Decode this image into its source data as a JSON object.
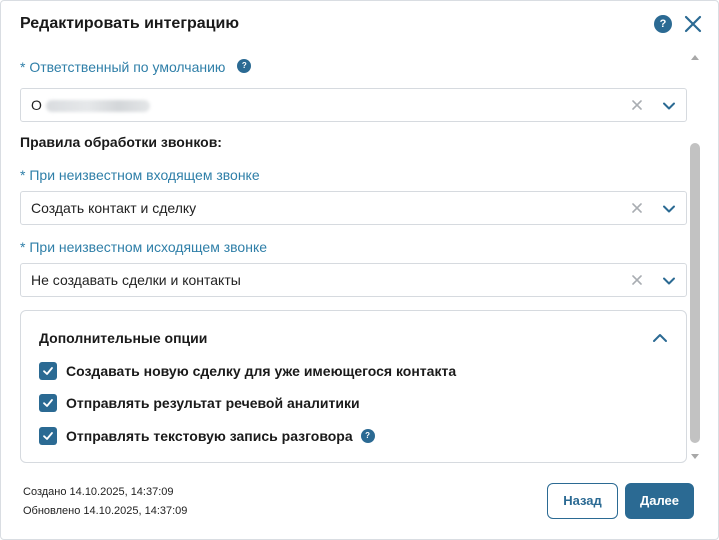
{
  "dialog": {
    "title": "Редактировать интеграцию",
    "help_icon": "?"
  },
  "responsible": {
    "required_mark": "*",
    "label": "Ответственный по умолчанию",
    "help_icon": "?",
    "value_prefix": "О"
  },
  "rules_title": "Правила обработки звонков:",
  "incoming": {
    "required_mark": "*",
    "label": "При неизвестном входящем звонке",
    "value": "Создать контакт и сделку"
  },
  "outgoing": {
    "required_mark": "*",
    "label": "При неизвестном исходящем звонке",
    "value": "Не создавать сделки и контакты"
  },
  "options": {
    "title": "Дополнительные опции",
    "items": [
      {
        "label": "Создавать новую сделку для уже имеющегося контакта",
        "checked": true
      },
      {
        "label": "Отправлять результат речевой аналитики",
        "checked": true
      },
      {
        "label": "Отправлять текстовую запись разговора",
        "checked": true,
        "help_icon": "?"
      }
    ]
  },
  "footer": {
    "created": "Создано 14.10.2025, 14:37:09",
    "updated": "Обновлено 14.10.2025, 14:37:09",
    "back_label": "Назад",
    "next_label": "Далее"
  },
  "colors": {
    "accent": "#2b6a93",
    "label": "#2f7fa8",
    "border": "#d6dadf"
  }
}
